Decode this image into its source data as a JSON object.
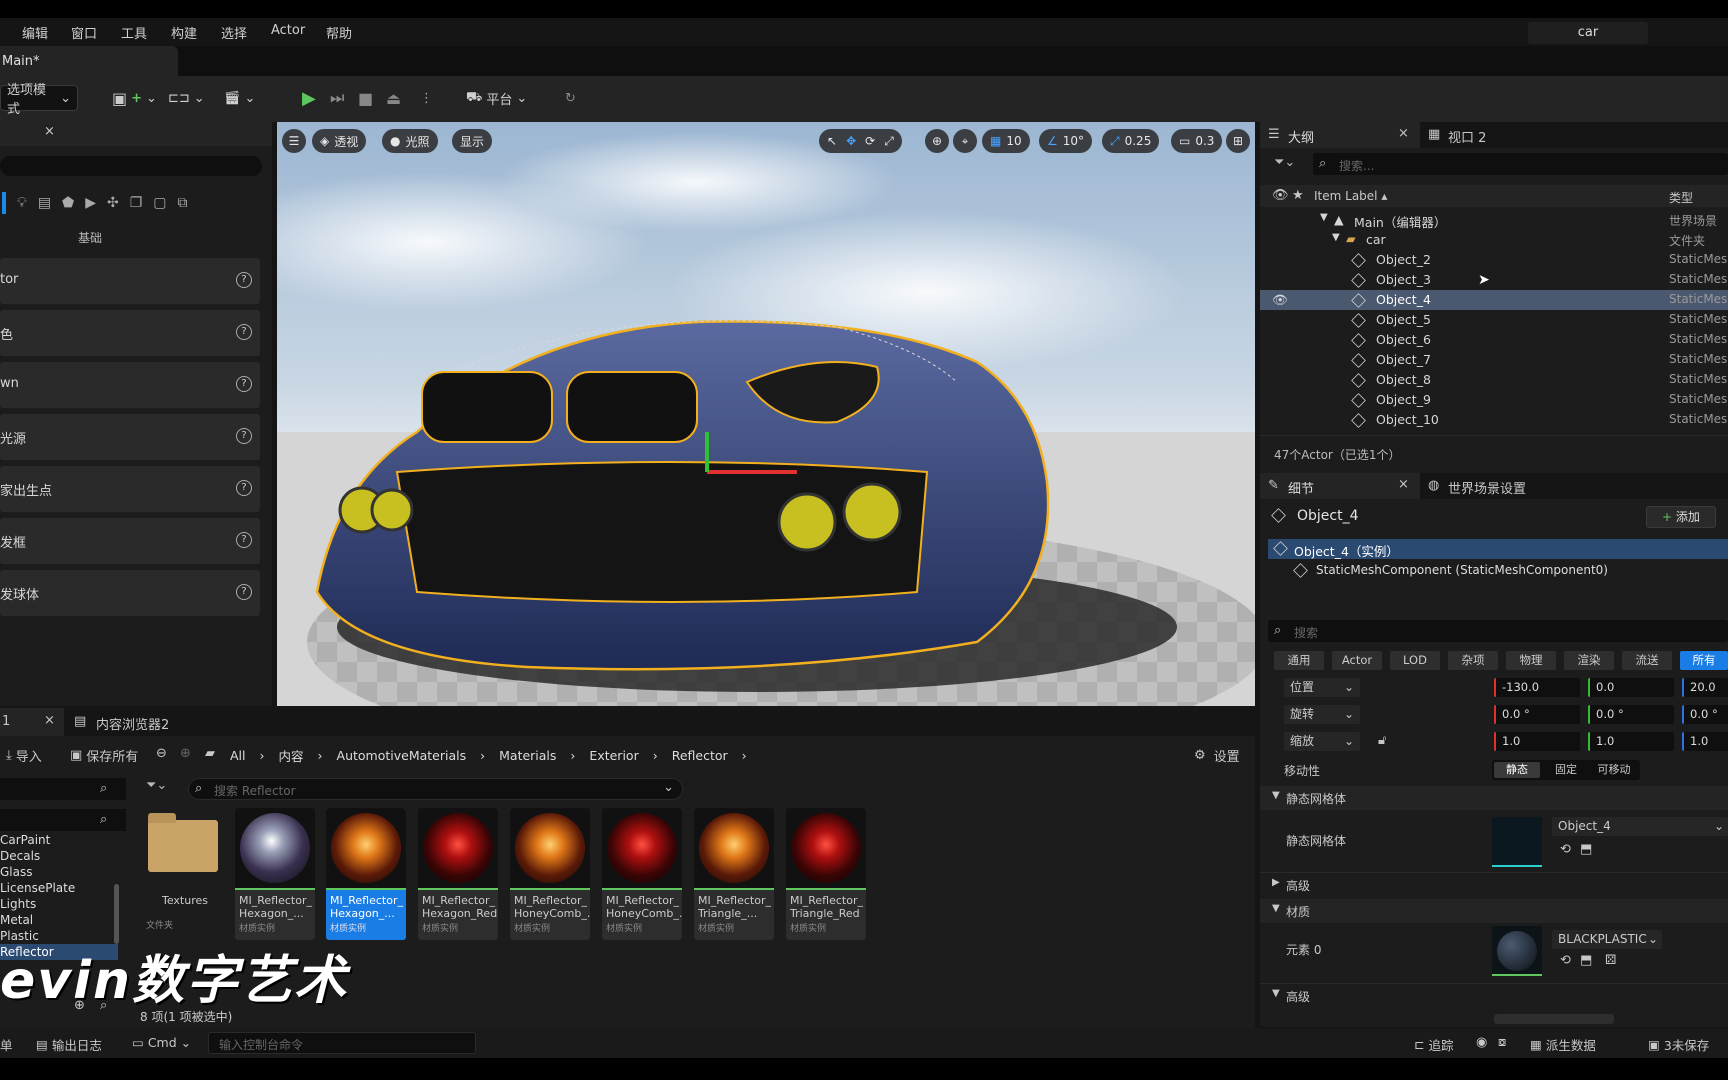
{
  "menu": [
    "编辑",
    "窗口",
    "工具",
    "构建",
    "选择",
    "Actor",
    "帮助"
  ],
  "project_name": "car",
  "level_tab": "Main*",
  "toolbar": {
    "mode": "选项模式",
    "platform": "平台"
  },
  "left_panel": {
    "section": "基础",
    "items": [
      "tor",
      "色",
      "wn",
      "光源",
      "家出生点",
      "发框",
      "发球体"
    ]
  },
  "viewport": {
    "perspective": "透视",
    "lighting": "光照",
    "show": "显示",
    "grid_snap": "10",
    "rot_snap": "10°",
    "scale_snap": "0.25",
    "cam_speed": "0.3"
  },
  "outliner": {
    "tab": "大纲",
    "tab2": "视口 2",
    "search_placeholder": "搜索...",
    "col_label": "Item Label ▴",
    "col_type": "类型",
    "rows": [
      {
        "label": "Main（编辑器）",
        "type": "世界场景"
      },
      {
        "label": "car",
        "type": "文件夹"
      },
      {
        "label": "Object_2",
        "type": "StaticMes"
      },
      {
        "label": "Object_3",
        "type": "StaticMes"
      },
      {
        "label": "Object_4",
        "type": "StaticMes"
      },
      {
        "label": "Object_5",
        "type": "StaticMes"
      },
      {
        "label": "Object_6",
        "type": "StaticMes"
      },
      {
        "label": "Object_7",
        "type": "StaticMes"
      },
      {
        "label": "Object_8",
        "type": "StaticMes"
      },
      {
        "label": "Object_9",
        "type": "StaticMes"
      },
      {
        "label": "Object_10",
        "type": "StaticMes"
      }
    ],
    "summary": "47个Actor（已选1个）"
  },
  "details": {
    "tab": "细节",
    "tab2": "世界场景设置",
    "object": "Object_4",
    "add": "添加",
    "instance": "Object_4（实例）",
    "component": "StaticMeshComponent (StaticMeshComponent0)",
    "search_placeholder": "搜索",
    "categories": [
      "通用",
      "Actor",
      "LOD",
      "杂项",
      "物理",
      "渲染",
      "流送",
      "所有"
    ],
    "location": {
      "label": "位置",
      "x": "-130.0",
      "y": "0.0",
      "z": "20.0"
    },
    "rotation": {
      "label": "旋转",
      "x": "0.0 °",
      "y": "0.0 °",
      "z": "0.0 °"
    },
    "scale": {
      "label": "缩放",
      "x": "1.0",
      "y": "1.0",
      "z": "1.0"
    },
    "mobility": {
      "label": "移动性",
      "options": [
        "静态",
        "固定",
        "可移动"
      ]
    },
    "static_mesh_section": "静态网格体",
    "static_mesh_label": "静态网格体",
    "static_mesh_value": "Object_4",
    "advanced": "高级",
    "materials_section": "材质",
    "element0": "元素 0",
    "material_value": "BLACKPLASTIC",
    "advanced2": "高级"
  },
  "content_browser": {
    "tab1": "1",
    "tab2": "内容浏览器2",
    "import": "导入",
    "save_all": "保存所有",
    "settings": "设置",
    "breadcrumb": [
      "All",
      "内容",
      "AutomotiveMaterials",
      "Materials",
      "Exterior",
      "Reflector"
    ],
    "search_placeholder": "搜索 Reflector",
    "folders": [
      "CarPaint",
      "Decals",
      "Glass",
      "LicensePlate",
      "Lights",
      "Metal",
      "Plastic",
      "Reflector"
    ],
    "folder_asset": {
      "name": "Textures",
      "type": "文件夹"
    },
    "assets": [
      {
        "name": "MI_Reflector_",
        "name2": "Hexagon_...",
        "type": "材质实例"
      },
      {
        "name": "MI_Reflector_",
        "name2": "Hexagon_...",
        "type": "材质实例"
      },
      {
        "name": "MI_Reflector_",
        "name2": "Hexagon_Red",
        "type": "材质实例"
      },
      {
        "name": "MI_Reflector_",
        "name2": "HoneyComb_...",
        "type": "材质实例"
      },
      {
        "name": "MI_Reflector_",
        "name2": "HoneyComb_...",
        "type": "材质实例"
      },
      {
        "name": "MI_Reflector_",
        "name2": "Triangle_...",
        "type": "材质实例"
      },
      {
        "name": "MI_Reflector_",
        "name2": "Triangle_Red",
        "type": "材质实例"
      }
    ],
    "count": "8 项(1 项被选中)"
  },
  "watermark": "evin数字艺术",
  "statusbar": {
    "left": "单",
    "output_log": "输出日志",
    "cmd": "Cmd",
    "console_placeholder": "输入控制台命令",
    "trace": "追踪",
    "derived": "派生数据",
    "unsaved": "3未保存"
  }
}
